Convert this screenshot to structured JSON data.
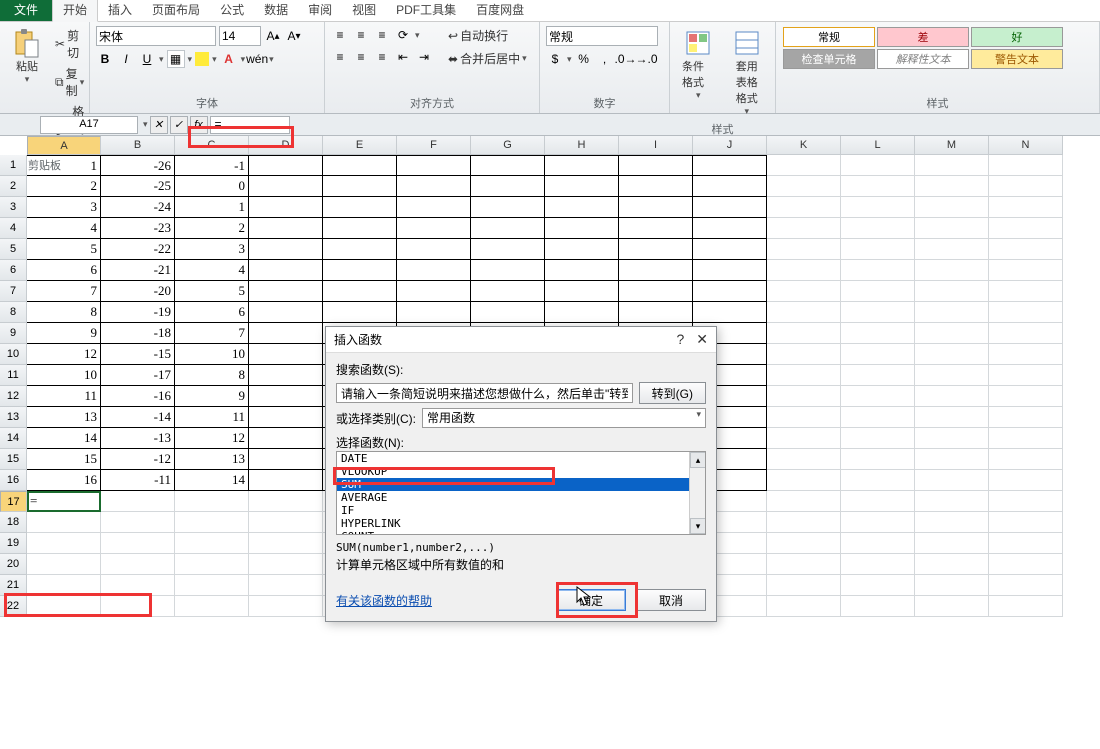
{
  "tabs": {
    "file": "文件",
    "items": [
      "开始",
      "插入",
      "页面布局",
      "公式",
      "数据",
      "审阅",
      "视图",
      "PDF工具集",
      "百度网盘"
    ],
    "active_index": 0
  },
  "ribbon": {
    "clipboard": {
      "label": "剪贴板",
      "paste": "粘贴",
      "cut": "剪切",
      "copy": "复制",
      "format_painter": "格式刷"
    },
    "font": {
      "label": "字体",
      "name": "宋体",
      "size": "14"
    },
    "align": {
      "label": "对齐方式",
      "wrap": "自动换行",
      "merge": "合并后居中"
    },
    "number": {
      "label": "数字",
      "format": "常规"
    },
    "styles_group": {
      "cond_format": "条件格式",
      "table_format": "套用\n表格格式",
      "label": "样式"
    },
    "style_cells": {
      "normal": "常规",
      "bad": "差",
      "good": "好",
      "check": "检查单元格",
      "explain": "解释性文本",
      "warn": "警告文本"
    }
  },
  "formula_bar": {
    "name_box": "A17",
    "formula": "="
  },
  "columns": [
    "A",
    "B",
    "C",
    "D",
    "E",
    "F",
    "G",
    "H",
    "I",
    "J",
    "K",
    "L",
    "M",
    "N"
  ],
  "row_count": 22,
  "active_cell": {
    "row": 17,
    "col": 0,
    "display": "="
  },
  "table": {
    "rows": [
      {
        "a": "1",
        "b": "-26",
        "c": "-1"
      },
      {
        "a": "2",
        "b": "-25",
        "c": "0"
      },
      {
        "a": "3",
        "b": "-24",
        "c": "1"
      },
      {
        "a": "4",
        "b": "-23",
        "c": "2"
      },
      {
        "a": "5",
        "b": "-22",
        "c": "3"
      },
      {
        "a": "6",
        "b": "-21",
        "c": "4"
      },
      {
        "a": "7",
        "b": "-20",
        "c": "5"
      },
      {
        "a": "8",
        "b": "-19",
        "c": "6"
      },
      {
        "a": "9",
        "b": "-18",
        "c": "7"
      },
      {
        "a": "12",
        "b": "-15",
        "c": "10"
      },
      {
        "a": "10",
        "b": "-17",
        "c": "8"
      },
      {
        "a": "11",
        "b": "-16",
        "c": "9"
      },
      {
        "a": "13",
        "b": "-14",
        "c": "11"
      },
      {
        "a": "14",
        "b": "-13",
        "c": "12"
      },
      {
        "a": "15",
        "b": "-12",
        "c": "13"
      },
      {
        "a": "16",
        "b": "-11",
        "c": "14"
      }
    ]
  },
  "dialog": {
    "title": "插入函数",
    "search_label": "搜索函数(S):",
    "search_placeholder": "请输入一条简短说明来描述您想做什么，然后单击\"转到\"",
    "goto": "转到(G)",
    "category_label": "或选择类别(C):",
    "category_value": "常用函数",
    "select_label": "选择函数(N):",
    "functions": [
      "DATE",
      "VLOOKUP",
      "SUM",
      "AVERAGE",
      "IF",
      "HYPERLINK",
      "COUNT"
    ],
    "selected_index": 2,
    "syntax": "SUM(number1,number2,...)",
    "description": "计算单元格区域中所有数值的和",
    "help_link": "有关该函数的帮助",
    "ok": "确定",
    "cancel": "取消"
  }
}
